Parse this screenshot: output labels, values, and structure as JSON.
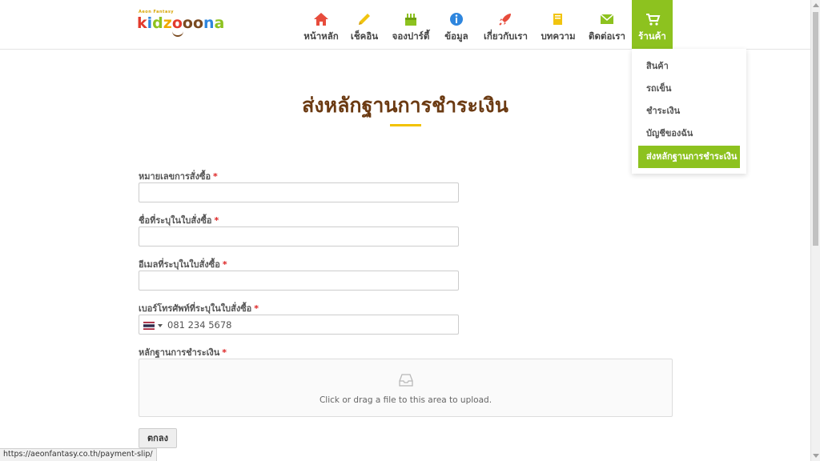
{
  "header": {
    "logo_small": "Aeon Fantasy",
    "logo_word": "kidzoona",
    "nav": [
      {
        "label": "หน้าหลัก",
        "icon": "home-icon",
        "color": "#e74c3c"
      },
      {
        "label": "เช็คอิน",
        "icon": "pencil-icon",
        "color": "#f1c40f"
      },
      {
        "label": "จองปาร์ตี้",
        "icon": "cake-icon",
        "color": "#8dc21f"
      },
      {
        "label": "ข้อมูล",
        "icon": "info-icon",
        "color": "#2e86de"
      },
      {
        "label": "เกี่ยวกับเรา",
        "icon": "rocket-icon",
        "color": "#e74c3c"
      },
      {
        "label": "บทความ",
        "icon": "book-icon",
        "color": "#f1c40f"
      },
      {
        "label": "ติดต่อเรา",
        "icon": "envelope-icon",
        "color": "#8dc21f"
      },
      {
        "label": "ร้านค้า",
        "icon": "cart-icon",
        "color": "#ffffff"
      }
    ],
    "dropdown": [
      "สินค้า",
      "รถเข็น",
      "ชำระเงิน",
      "บัญชีของฉัน",
      "ส่งหลักฐานการชำระเงิน"
    ]
  },
  "main": {
    "title": "ส่งหลักฐานการชำระเงิน",
    "fields": {
      "order_number_label": "หมายเลขการสั่งซื้อ",
      "order_name_label": "ชื่อที่ระบุในใบสั่งซื้อ",
      "email_label": "อีเมลที่ระบุในใบสั่งซื้อ",
      "phone_label": "เบอร์โทรศัพท์ที่ระบุในใบสั่งซื้อ",
      "phone_placeholder": "081 234 5678",
      "proof_label": "หลักฐานการชำระเงิน",
      "required_mark": "*"
    },
    "upload_text": "Click or drag a file to this area to upload.",
    "submit_label": "ตกลง"
  },
  "status_bar": {
    "url": "https://aeonfantasy.co.th/payment-slip/"
  },
  "colors": {
    "accent": "#8dc21f",
    "title": "#6b3a12",
    "title_bar": "#f2c200",
    "required": "#dd2222"
  }
}
